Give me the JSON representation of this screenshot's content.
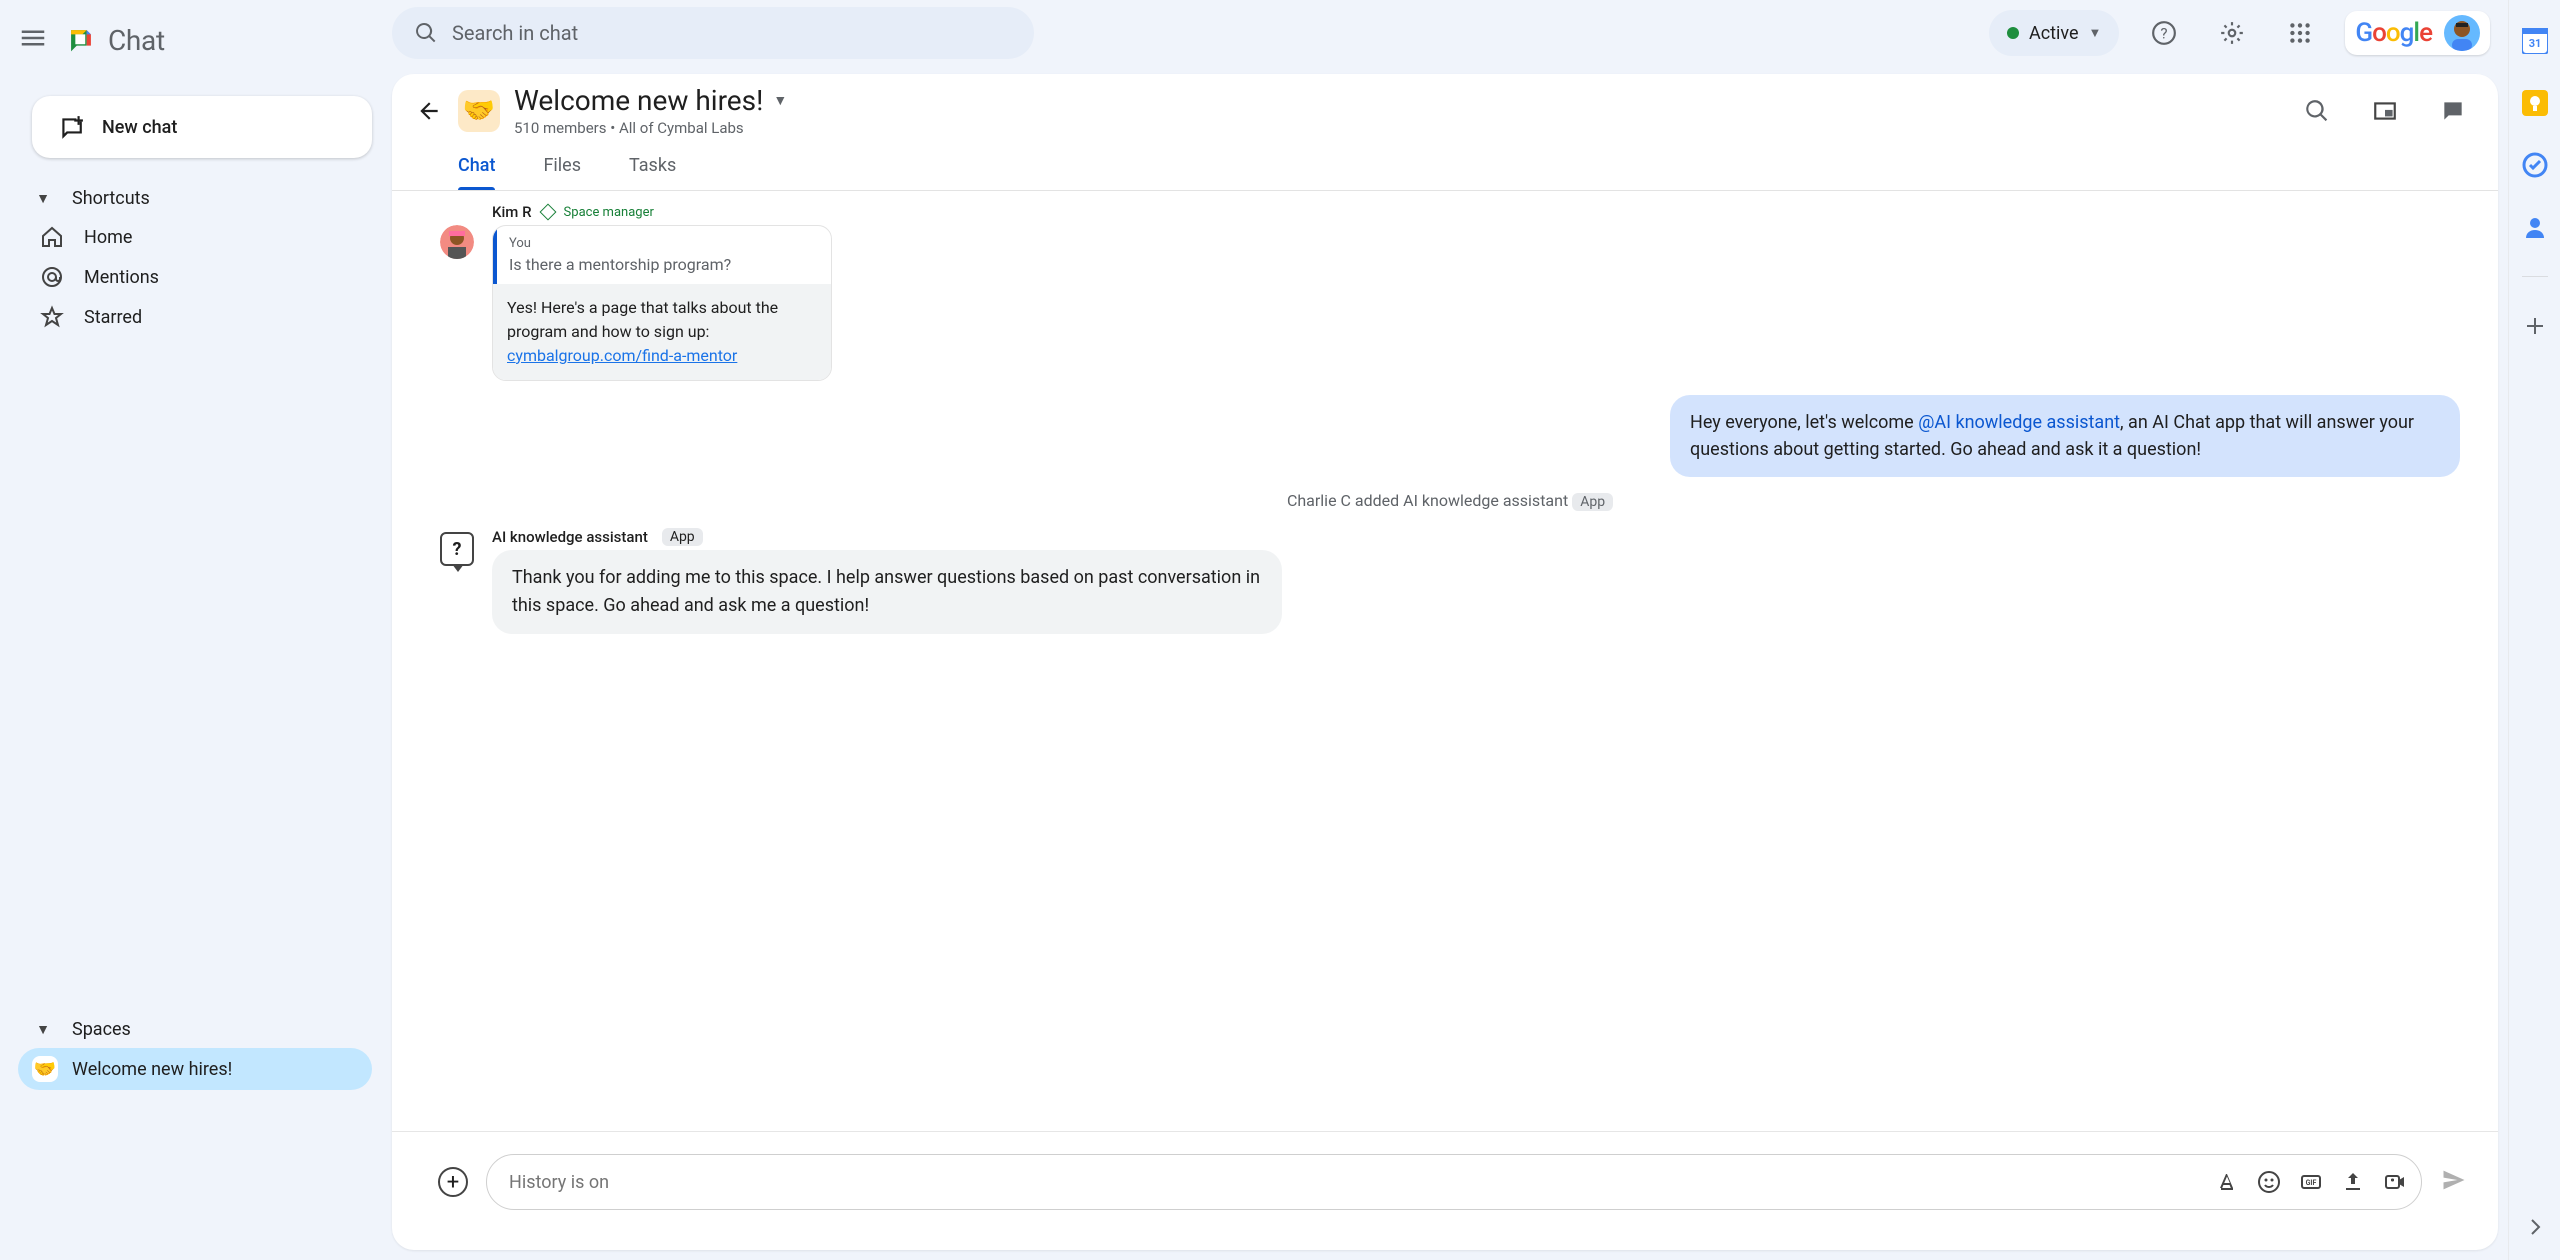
{
  "brand": "Chat",
  "newchat_label": "New chat",
  "shortcuts": {
    "header": "Shortcuts",
    "items": [
      {
        "label": "Home"
      },
      {
        "label": "Mentions"
      },
      {
        "label": "Starred"
      }
    ]
  },
  "spaces": {
    "header": "Spaces",
    "items": [
      {
        "emoji": "🤝",
        "label": "Welcome new hires!",
        "active": true
      }
    ]
  },
  "search_placeholder": "Search in chat",
  "status": {
    "label": "Active"
  },
  "google_word": "Google",
  "conversation": {
    "emoji": "🤝",
    "title": "Welcome new hires!",
    "members": "510 members",
    "scope": "All of Cymbal Labs",
    "tabs": [
      "Chat",
      "Files",
      "Tasks"
    ],
    "active_tab": 0
  },
  "messages": {
    "kim": {
      "name": "Kim R",
      "role": "Space manager",
      "quote_who": "You",
      "quote_text": "Is there a mentorship program?",
      "reply_pre": "Yes! Here's a page that talks about the program and how to sign up: ",
      "reply_link": "cymbalgroup.com/find-a-mentor"
    },
    "own": {
      "pre": "Hey everyone, let's welcome ",
      "mention": "@AI knowledge assistant",
      "post": ", an AI Chat app that will answer your questions about getting started.  Go ahead and ask it a question!"
    },
    "system": {
      "text": "Charlie C added AI knowledge assistant",
      "chip": "App"
    },
    "ai": {
      "name": "AI knowledge assistant",
      "chip": "App",
      "text": "Thank you for adding me to this space. I help answer questions based on past conversation in this space. Go ahead and ask me a question!"
    }
  },
  "composer_placeholder": "History is on"
}
